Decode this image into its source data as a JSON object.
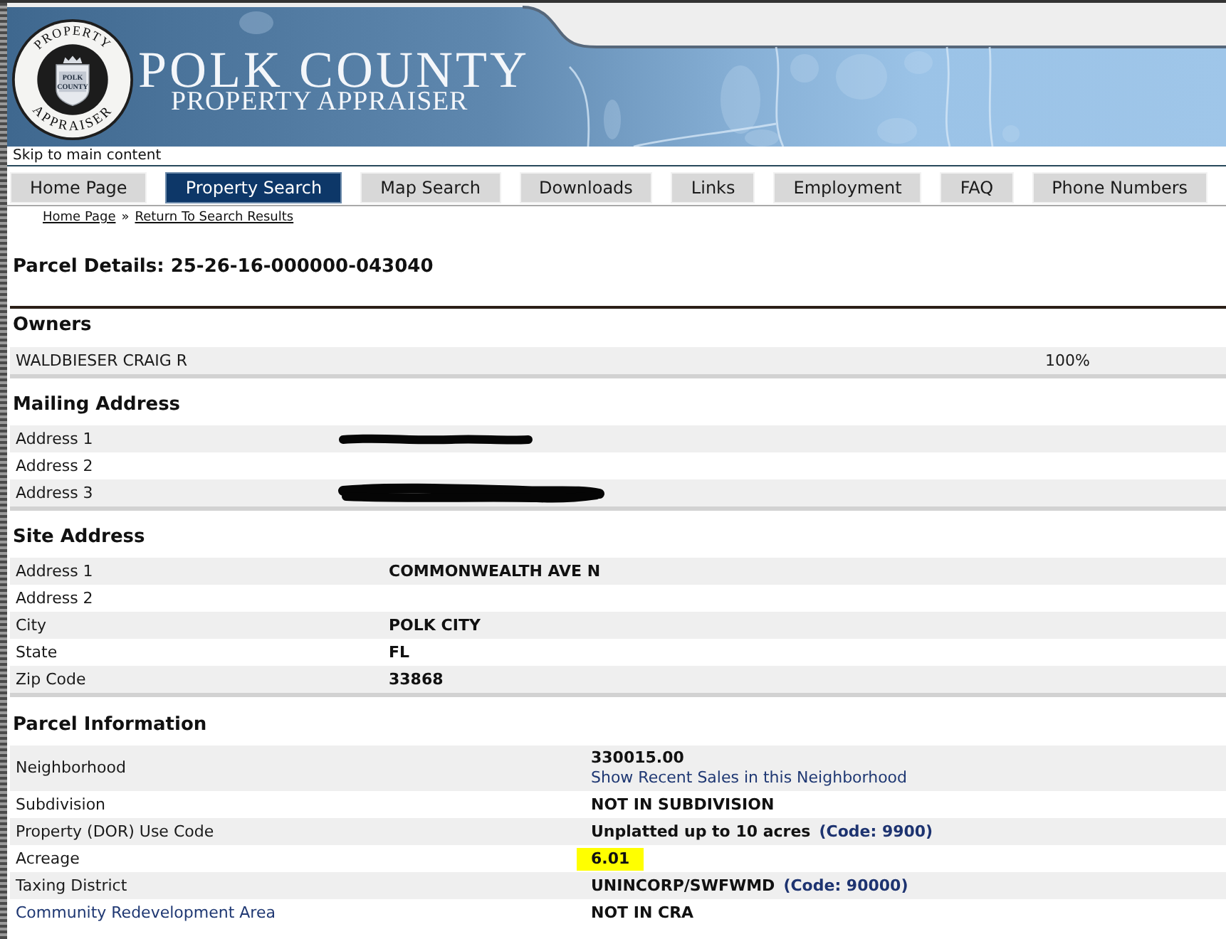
{
  "header": {
    "title": "POLK COUNTY",
    "subtitle": "PROPERTY APPRAISER",
    "seal": {
      "top_text": "PROPERTY",
      "bottom_text": "APPRAISER",
      "shield_lines": [
        "POLK",
        "COUNTY"
      ]
    }
  },
  "skip_link": "Skip to main content",
  "nav_tabs": [
    {
      "label": "Home Page",
      "selected": false
    },
    {
      "label": "Property Search",
      "selected": true
    },
    {
      "label": "Map Search",
      "selected": false
    },
    {
      "label": "Downloads",
      "selected": false
    },
    {
      "label": "Links",
      "selected": false
    },
    {
      "label": "Employment",
      "selected": false
    },
    {
      "label": "FAQ",
      "selected": false
    },
    {
      "label": "Phone Numbers",
      "selected": false
    }
  ],
  "breadcrumb": {
    "links": [
      "Home Page",
      "Return To Search Results"
    ],
    "separator": "»"
  },
  "page_title": "Parcel Details: 25-26-16-000000-043040",
  "owners": {
    "title": "Owners",
    "rows": [
      {
        "name": "WALDBIESER CRAIG R",
        "share": "100%"
      }
    ]
  },
  "mailing_address": {
    "title": "Mailing Address",
    "rows": [
      {
        "label": "Address 1",
        "redacted": true
      },
      {
        "label": "Address 2",
        "redacted": false
      },
      {
        "label": "Address 3",
        "redacted": true
      }
    ]
  },
  "site_address": {
    "title": "Site Address",
    "rows": [
      {
        "label": "Address 1",
        "value": "COMMONWEALTH AVE N"
      },
      {
        "label": "Address 2"
      },
      {
        "label": "City",
        "value": "POLK CITY"
      },
      {
        "label": "State",
        "value": "FL"
      },
      {
        "label": "Zip Code",
        "value": "33868"
      }
    ]
  },
  "parcel_information": {
    "title": "Parcel Information",
    "rows": [
      {
        "label": "Neighborhood",
        "label_link": false,
        "value": "330015.00",
        "link": "Show Recent Sales in this Neighborhood",
        "highlighted": false
      },
      {
        "label": "Subdivision",
        "label_link": false,
        "value": "NOT IN SUBDIVISION",
        "highlighted": false
      },
      {
        "label": "Property (DOR) Use Code",
        "label_link": false,
        "value": "Unplatted up to 10 acres",
        "code": "(Code: 9900)",
        "highlighted": false
      },
      {
        "label": "Acreage",
        "label_link": false,
        "value": "6.01",
        "highlighted": true
      },
      {
        "label": "Taxing District",
        "label_link": false,
        "value": "UNINCORP/SWFWMD",
        "code": "(Code: 90000)",
        "highlighted": false
      },
      {
        "label": "Community Redevelopment Area",
        "label_link": true,
        "value": "NOT IN CRA",
        "highlighted": false
      }
    ]
  }
}
